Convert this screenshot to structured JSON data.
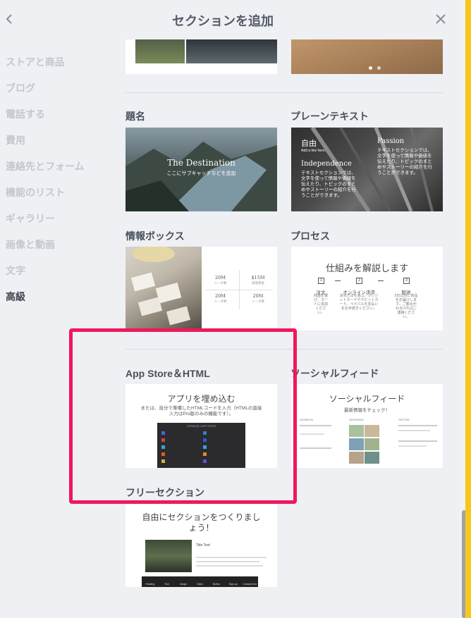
{
  "header": {
    "title": "セクションを追加"
  },
  "sidebar": {
    "items": [
      {
        "label": "ストアと商品"
      },
      {
        "label": "ブログ"
      },
      {
        "label": "電話する"
      },
      {
        "label": "費用"
      },
      {
        "label": "連絡先とフォーム"
      },
      {
        "label": "機能のリスト"
      },
      {
        "label": "ギャラリー"
      },
      {
        "label": "画像と動画"
      },
      {
        "label": "文字"
      },
      {
        "label": "高級"
      }
    ]
  },
  "sections": {
    "title_section": {
      "label": "題名",
      "thumb_heading": "The Destination",
      "thumb_sub": "ここにサブキャッチなどを追加"
    },
    "plain_text": {
      "label": "プレーンテキスト",
      "col1_heading": "自由",
      "col1_small": "Add a line here.",
      "col1_heading2": "Independence",
      "col1_body": "テキストセクションでは、文字を使って情報や価値を伝えたり、トピックのまとめやストーリーの紹介を行うことができます。",
      "col2_heading": "Passion",
      "col2_body": "テキストセクションでは、文字を使って情報や価値を伝えたり、トピックのまとめやストーリーの紹介を行うことができます。"
    },
    "info_box": {
      "label": "情報ボックス",
      "stats": [
        {
          "value": "20M",
          "caption": "リーダ数"
        },
        {
          "value": "$15M",
          "caption": "調達資金"
        },
        {
          "value": "20M",
          "caption": "リーダ数"
        },
        {
          "value": "20M",
          "caption": "リーダ数"
        }
      ]
    },
    "process": {
      "label": "プロセス",
      "thumb_title": "仕組みを解説します",
      "steps": [
        {
          "num": "1",
          "title": "注文",
          "text": "商品を選び、カートに追加ください。"
        },
        {
          "num": "2",
          "title": "オンライン決済",
          "text": "決済方法を選ぶ。クレジットカードやデビットカード、ペイパルを支払いをお手続きください。"
        },
        {
          "num": "3",
          "title": "配送",
          "text": "5日以内に商品をお届けします。ご都合がわるければご連絡ください。"
        }
      ]
    },
    "app_store": {
      "label": "App Store＆HTML",
      "thumb_title": "アプリを埋め込む",
      "thumb_sub": "または、自分で準備したHTMLコードを入力（HTMLの直接入力はPro版のみの機能です）。",
      "store_header": "STRIKINGLY APP STORE"
    },
    "social_feed": {
      "label": "ソーシャルフィード",
      "thumb_title": "ソーシャルフィード",
      "thumb_sub": "最新情報をチェック！",
      "columns": [
        "FACEBOOK",
        "INSTAGRAM",
        "TWITTER"
      ]
    },
    "free_section": {
      "label": "フリーセクション",
      "thumb_title": "自由にセクションをつくりましょう！",
      "block_title": "Title Text",
      "tools": [
        "Heading",
        "Text",
        "Image",
        "Video",
        "Button",
        "Sign-up",
        "Contact form"
      ]
    }
  }
}
